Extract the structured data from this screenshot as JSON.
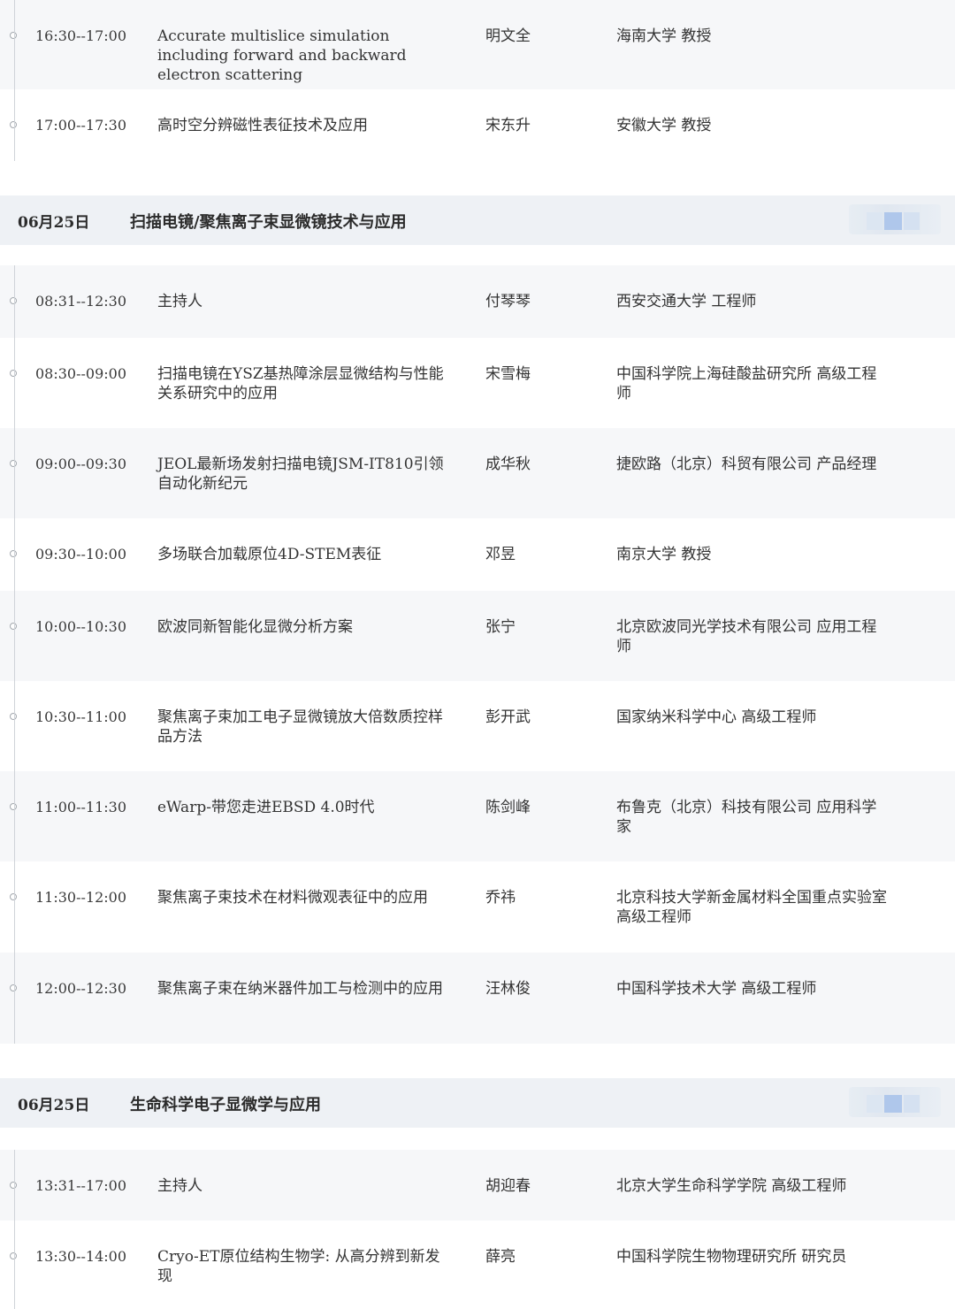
{
  "sections": [
    {
      "header": null,
      "rows": [
        {
          "time": "16:30--17:00",
          "topic": "Accurate multislice simulation including forward and backward electron scattering",
          "speaker": "明文全",
          "affiliation": "海南大学 教授"
        },
        {
          "time": "17:00--17:30",
          "topic": "高时空分辨磁性表征技术及应用",
          "speaker": "宋东升",
          "affiliation": "安徽大学 教授"
        }
      ]
    },
    {
      "header": {
        "date": "06月25日",
        "title": "扫描电镜/聚焦离子束显微镜技术与应用"
      },
      "rows": [
        {
          "time": "08:31--12:30",
          "topic": "主持人",
          "speaker": "付琴琴",
          "affiliation": "西安交通大学 工程师"
        },
        {
          "time": "08:30--09:00",
          "topic": "扫描电镜在YSZ基热障涂层显微结构与性能关系研究中的应用",
          "speaker": "宋雪梅",
          "affiliation": "中国科学院上海硅酸盐研究所 高级工程师"
        },
        {
          "time": "09:00--09:30",
          "topic": "JEOL最新场发射扫描电镜JSM-IT810引领自动化新纪元",
          "speaker": "成华秋",
          "affiliation": "捷欧路（北京）科贸有限公司 产品经理"
        },
        {
          "time": "09:30--10:00",
          "topic": "多场联合加载原位4D-STEM表征",
          "speaker": "邓昱",
          "affiliation": "南京大学 教授"
        },
        {
          "time": "10:00--10:30",
          "topic": "欧波同新智能化显微分析方案",
          "speaker": "张宁",
          "affiliation": "北京欧波同光学技术有限公司 应用工程师"
        },
        {
          "time": "10:30--11:00",
          "topic": "聚焦离子束加工电子显微镜放大倍数质控样品方法",
          "speaker": "彭开武",
          "affiliation": "国家纳米科学中心 高级工程师"
        },
        {
          "time": "11:00--11:30",
          "topic": "eWarp-带您走进EBSD 4.0时代",
          "speaker": "陈剑峰",
          "affiliation": "布鲁克（北京）科技有限公司 应用科学家"
        },
        {
          "time": "11:30--12:00",
          "topic": "聚焦离子束技术在材料微观表征中的应用",
          "speaker": "乔祎",
          "affiliation": "北京科技大学新金属材料全国重点实验室 高级工程师"
        },
        {
          "time": "12:00--12:30",
          "topic": "聚焦离子束在纳米器件加工与检测中的应用",
          "speaker": "汪林俊",
          "affiliation": "中国科学技术大学 高级工程师"
        }
      ]
    },
    {
      "header": {
        "date": "06月25日",
        "title": "生命科学电子显微学与应用"
      },
      "rows": [
        {
          "time": "13:31--17:00",
          "topic": "主持人",
          "speaker": "胡迎春",
          "affiliation": "北京大学生命科学学院 高级工程师"
        },
        {
          "time": "13:30--14:00",
          "topic": "Cryo-ET原位结构生物学: 从高分辨到新发现",
          "speaker": "薛亮",
          "affiliation": "中国科学院生物物理研究所 研究员"
        }
      ]
    }
  ]
}
